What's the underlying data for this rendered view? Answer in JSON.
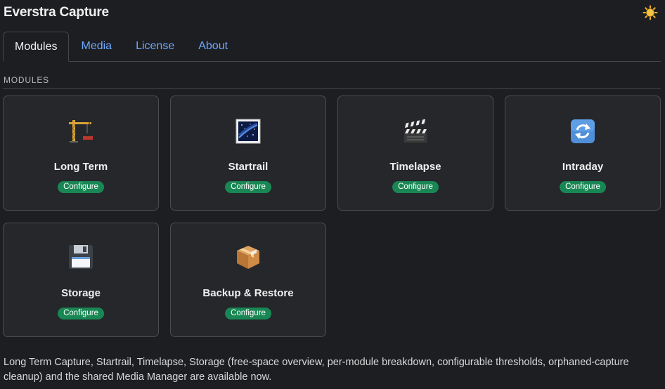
{
  "app": {
    "title": "Everstra Capture"
  },
  "header": {
    "theme_icon": "sun-icon"
  },
  "tabs": [
    {
      "label": "Modules",
      "active": true
    },
    {
      "label": "Media",
      "active": false
    },
    {
      "label": "License",
      "active": false
    },
    {
      "label": "About",
      "active": false
    }
  ],
  "section": {
    "label": "MODULES"
  },
  "modules": [
    {
      "name": "Long Term",
      "icon": "crane-icon",
      "action": "Configure"
    },
    {
      "name": "Startrail",
      "icon": "night-sky-icon",
      "action": "Configure"
    },
    {
      "name": "Timelapse",
      "icon": "clapper-board-icon",
      "action": "Configure"
    },
    {
      "name": "Intraday",
      "icon": "refresh-icon",
      "action": "Configure"
    },
    {
      "name": "Storage",
      "icon": "floppy-disk-icon",
      "action": "Configure"
    },
    {
      "name": "Backup & Restore",
      "icon": "package-icon",
      "action": "Configure"
    }
  ],
  "footer": {
    "text": "Long Term Capture, Startrail, Timelapse, Storage (free-space overview, per-module breakdown, configurable thresholds, orphaned-capture cleanup) and the shared Media Manager are available now."
  },
  "colors": {
    "background": "#1d1e22",
    "card": "#25272b",
    "tab_link": "#6ea8fe",
    "badge": "#198754"
  }
}
